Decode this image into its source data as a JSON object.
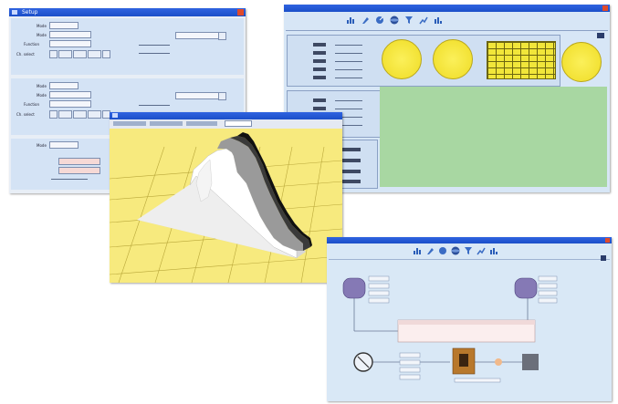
{
  "colors": {
    "titlebar": "#1b4fc8",
    "panel": "#d4e3f5",
    "gauge": "#f3e43c",
    "floor": "#f7ea7e",
    "green_area": "#a8d7a2",
    "close": "#e04a2a"
  },
  "icons": [
    "chart-icon",
    "tool-icon",
    "dial-icon",
    "sphere-icon",
    "filter-icon",
    "graph-icon",
    "chart-icon"
  ],
  "win1": {
    "title": "Setup",
    "labels": [
      "Mode",
      "Mode",
      "Function",
      "Ch. select",
      "Mode",
      "Mode",
      "Function",
      "Ch. select",
      "Mode"
    ]
  },
  "win2": {
    "title": ""
  },
  "win3": {
    "title": ""
  },
  "win4": {
    "title": ""
  }
}
